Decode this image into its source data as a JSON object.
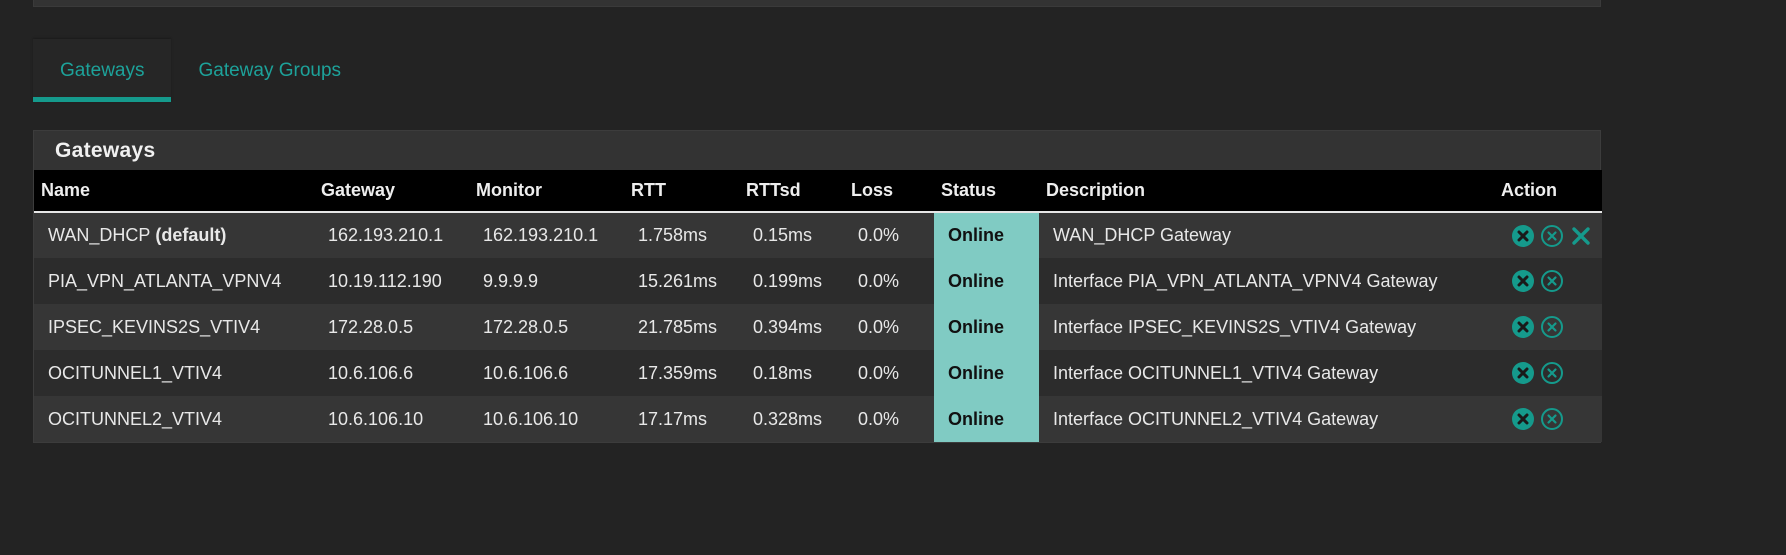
{
  "tabs": [
    {
      "label": "Gateways",
      "active": true
    },
    {
      "label": "Gateway Groups",
      "active": false
    }
  ],
  "panel": {
    "title": "Gateways",
    "columns": [
      "Name",
      "Gateway",
      "Monitor",
      "RTT",
      "RTTsd",
      "Loss",
      "Status",
      "Description",
      "Action"
    ],
    "rows": [
      {
        "name": "WAN_DHCP",
        "default_label": "(default)",
        "gateway": "162.193.210.1",
        "monitor": "162.193.210.1",
        "rtt": "1.758ms",
        "rttsd": "0.15ms",
        "loss": "0.0%",
        "status": "Online",
        "description": "WAN_DHCP Gateway",
        "actions": [
          "delete-icon",
          "disable-icon",
          "remove-icon"
        ]
      },
      {
        "name": "PIA_VPN_ATLANTA_VPNV4",
        "default_label": "",
        "gateway": "10.19.112.190",
        "monitor": "9.9.9.9",
        "rtt": "15.261ms",
        "rttsd": "0.199ms",
        "loss": "0.0%",
        "status": "Online",
        "description": "Interface PIA_VPN_ATLANTA_VPNV4 Gateway",
        "actions": [
          "delete-icon",
          "disable-icon"
        ]
      },
      {
        "name": "IPSEC_KEVINS2S_VTIV4",
        "default_label": "",
        "gateway": "172.28.0.5",
        "monitor": "172.28.0.5",
        "rtt": "21.785ms",
        "rttsd": "0.394ms",
        "loss": "0.0%",
        "status": "Online",
        "description": "Interface IPSEC_KEVINS2S_VTIV4 Gateway",
        "actions": [
          "delete-icon",
          "disable-icon"
        ]
      },
      {
        "name": "OCITUNNEL1_VTIV4",
        "default_label": "",
        "gateway": "10.6.106.6",
        "monitor": "10.6.106.6",
        "rtt": "17.359ms",
        "rttsd": "0.18ms",
        "loss": "0.0%",
        "status": "Online",
        "description": "Interface OCITUNNEL1_VTIV4 Gateway",
        "actions": [
          "delete-icon",
          "disable-icon"
        ]
      },
      {
        "name": "OCITUNNEL2_VTIV4",
        "default_label": "",
        "gateway": "10.6.106.10",
        "monitor": "10.6.106.10",
        "rtt": "17.17ms",
        "rttsd": "0.328ms",
        "loss": "0.0%",
        "status": "Online",
        "description": "Interface OCITUNNEL2_VTIV4 Gateway",
        "actions": [
          "delete-icon",
          "disable-icon"
        ]
      }
    ]
  },
  "colors": {
    "accent": "#159a8c",
    "tab_text": "#1da29a",
    "status_online_bg": "#80cbc3",
    "background": "#232323"
  }
}
